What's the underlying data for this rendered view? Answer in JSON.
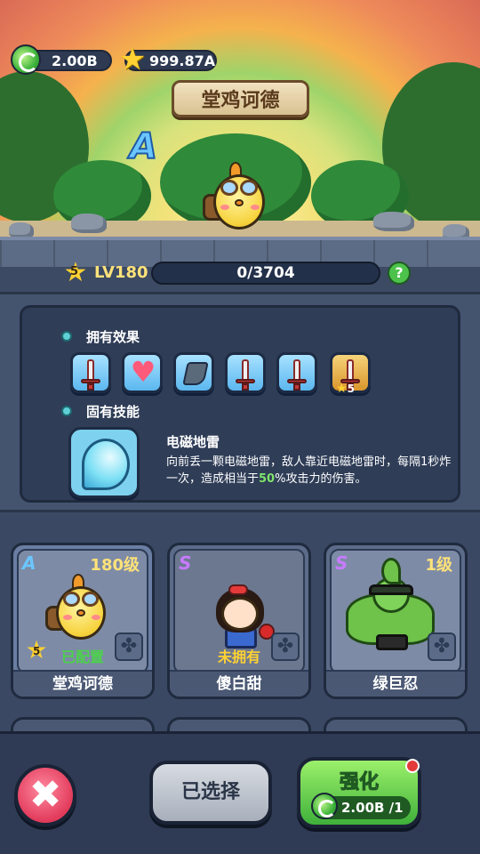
{
  "top": {
    "currency_gem": "2.00B",
    "currency_star": "999.87A",
    "hero_name": "堂鸡诃德",
    "hero_rank": "A"
  },
  "level": {
    "star_count": "5",
    "level_text": "LV180",
    "exp_text": "0/3704",
    "exp_fraction": 0,
    "help_label": "?"
  },
  "info": {
    "effects_title": "拥有效果",
    "effects": [
      {
        "icon": "sword-icon"
      },
      {
        "icon": "heart-icon"
      },
      {
        "icon": "boot-icon"
      },
      {
        "icon": "sword-icon"
      },
      {
        "icon": "sword-icon"
      },
      {
        "icon": "sword-icon",
        "badge": "5"
      }
    ],
    "skill_title": "固有技能",
    "skill_name": "电磁地雷",
    "skill_desc_1": "向前丢一颗电磁地雷，敌人靠近电磁地雷时，每隔1秒炸一次，造成相当于",
    "skill_desc_hl": "50",
    "skill_desc_2": "%攻击力的伤害。"
  },
  "cards": [
    {
      "rank": "A",
      "level": "180级",
      "status": "已配置",
      "name": "堂鸡诃德",
      "star": "5",
      "rank_color": "#6bc6ff",
      "status_color": "#4cd24a"
    },
    {
      "rank": "S",
      "level": "",
      "status": "未拥有",
      "name": "傻白甜",
      "rank_color": "#c77bff",
      "status_color": "#ffd233"
    },
    {
      "rank": "S",
      "level": "1级",
      "status": "",
      "name": "绿巨忍",
      "rank_color": "#c77bff",
      "status_color": "#ffd233"
    }
  ],
  "bottom": {
    "close_label": "✖",
    "selected_label": "已选择",
    "upgrade_label": "强化",
    "upgrade_cost": "2.00B /1"
  }
}
